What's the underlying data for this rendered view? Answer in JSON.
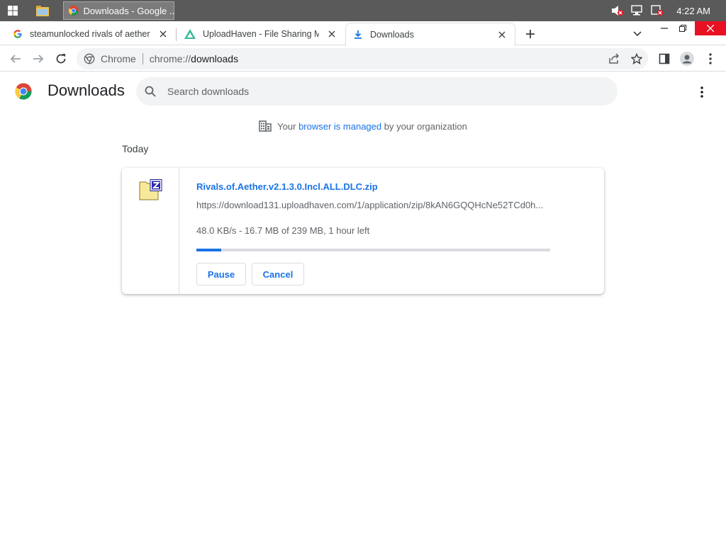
{
  "taskbar": {
    "task_label": "Downloads - Google ...",
    "clock": "4:22 AM"
  },
  "tabs": [
    {
      "title": "steamunlocked rivals of aether -",
      "icon": "google-g-icon"
    },
    {
      "title": "UploadHaven - File Sharing Mad",
      "icon": "uploadhaven-icon"
    },
    {
      "title": "Downloads",
      "icon": "download-arrow-icon",
      "active": true
    }
  ],
  "omnibox": {
    "chip": "Chrome",
    "url_scheme": "chrome://",
    "url_host": "downloads"
  },
  "page": {
    "title": "Downloads",
    "search_placeholder": "Search downloads",
    "managed_prefix": "Your",
    "managed_link": "browser is managed",
    "managed_suffix": "by your organization",
    "section_date": "Today"
  },
  "download": {
    "file_name": "Rivals.of.Aether.v2.1.3.0.Incl.ALL.DLC.zip",
    "url": "https://download131.uploadhaven.com/1/application/zip/8kAN6GQQHcNe52TCd0h...",
    "status": "48.0 KB/s - 16.7 MB of 239 MB, 1 hour left",
    "progress_percent": 7,
    "pause_label": "Pause",
    "cancel_label": "Cancel"
  },
  "colors": {
    "accent": "#1a73e8",
    "taskbar": "#5a5a5a",
    "close_button": "#e81123"
  }
}
